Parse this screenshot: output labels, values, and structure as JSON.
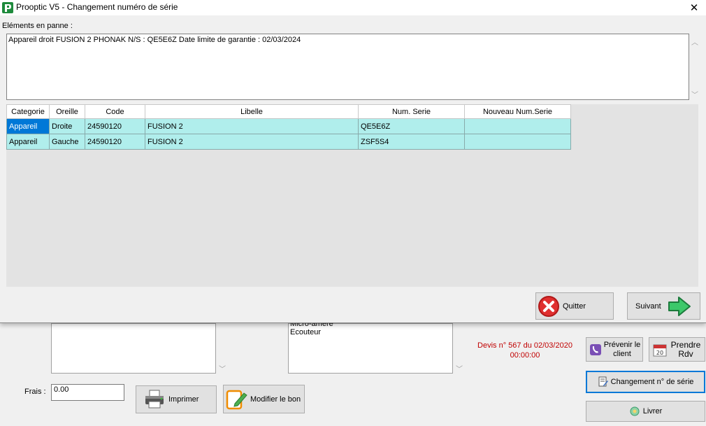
{
  "dialog": {
    "title": "Prooptic V5 - Changement numéro de série",
    "close_glyph": "✕",
    "section_label": "Eléments en panne :",
    "memo_text": "Appareil droit FUSION 2 PHONAK N/S : QE5E6Z  Date limite de garantie : 02/03/2024",
    "table": {
      "headers": [
        "Categorie",
        "Oreille",
        "Code",
        "Libelle",
        "Num. Serie",
        "Nouveau Num.Serie"
      ],
      "rows": [
        [
          "Appareil",
          "Droite",
          "24590120",
          "FUSION 2",
          "QE5E6Z",
          ""
        ],
        [
          "Appareil",
          "Gauche",
          "24590120",
          "FUSION 2",
          "ZSF5S4",
          ""
        ]
      ]
    },
    "buttons": {
      "quit": "Quitter",
      "next": "Suivant"
    },
    "colors": {
      "row_bg": "#b0eeec",
      "selected_bg": "#0078d7"
    }
  },
  "background": {
    "textarea2_lines": [
      "Micro-amere",
      "Ecouteur"
    ],
    "frais_label": "Frais :",
    "frais_value": "0.00",
    "buttons": {
      "print": "Imprimer",
      "edit_voucher": "Modifier le bon",
      "notify_line1": "Prévenir le",
      "notify_line2": "client",
      "appointment_line1": "Prendre",
      "appointment_line2": "Rdv",
      "serial_change": "Changement n° de série",
      "deliver": "Livrer"
    },
    "devis_line1": "Devis n° 567 du 02/03/2020",
    "devis_line2": "00:00:00",
    "devis_color": "#c00000"
  }
}
